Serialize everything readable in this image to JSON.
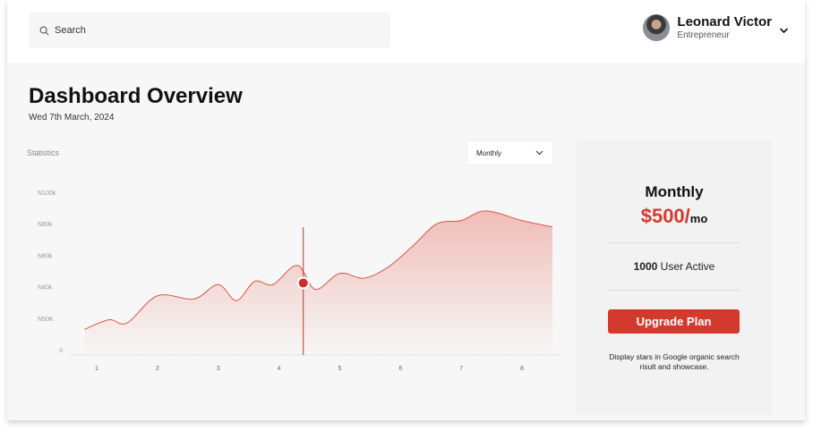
{
  "search": {
    "placeholder": "Search"
  },
  "user": {
    "name": "Leonard Victor",
    "role": "Entrepreneur"
  },
  "page": {
    "title": "Dashboard Overview",
    "date": "Wed 7th March, 2024"
  },
  "statistics": {
    "label": "Statistics",
    "period": "Monthly"
  },
  "chart_data": {
    "type": "area",
    "title": "",
    "xlabel": "",
    "ylabel": "",
    "categories": [
      "1",
      "2",
      "3",
      "4",
      "5",
      "6",
      "7",
      "8"
    ],
    "y_tick_labels": [
      "0",
      "N50K",
      "N40k",
      "N60k",
      "N80k",
      "N100k"
    ],
    "ylim": [
      0,
      100
    ],
    "grid": false,
    "x": [
      0.8,
      1.2,
      1.5,
      2.0,
      2.6,
      3.0,
      3.3,
      3.6,
      3.9,
      4.3,
      4.6,
      5.0,
      5.4,
      5.8,
      6.2,
      6.6,
      7.0,
      7.4,
      8.0,
      8.5
    ],
    "y": [
      16,
      22,
      20,
      37,
      35,
      44,
      34,
      46,
      44,
      56,
      41,
      51,
      48,
      55,
      68,
      82,
      84,
      90,
      84,
      80
    ],
    "highlight": {
      "x": 4.4,
      "y": 45
    },
    "colors": {
      "line": "#d9564b",
      "fill": "#f0b9b4",
      "marker": "#c83228"
    }
  },
  "plan": {
    "name": "Monthly",
    "price": "$500/",
    "unit": "mo",
    "users_count": "1000",
    "users_text": " User Active",
    "button": "Upgrade Plan",
    "description": "Display stars in Google organic search risult and showcase."
  }
}
